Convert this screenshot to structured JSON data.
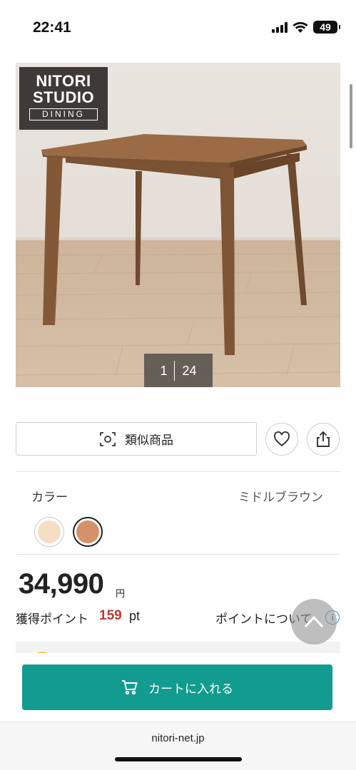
{
  "status_bar": {
    "time": "22:41",
    "battery": "49"
  },
  "product": {
    "brand_logo": {
      "line1": "NITORI",
      "line2": "STUDIO",
      "line3": "DINING"
    },
    "image_counter": {
      "current": "1",
      "total": "24"
    }
  },
  "actions": {
    "similar_label": "類似商品",
    "favorite_icon": "heart-icon",
    "share_icon": "share-icon"
  },
  "color": {
    "label": "カラー",
    "selected_value": "ミドルブラウン",
    "swatches": [
      {
        "color": "#f5dec4",
        "selected": false
      },
      {
        "color": "#d6906a",
        "selected": true
      }
    ]
  },
  "price": {
    "amount": "34,990",
    "unit": "円"
  },
  "points": {
    "label": "獲得ポイント",
    "value": "159",
    "unit": "pt",
    "info_label": "ポイントについて"
  },
  "cart": {
    "button_label": "カートに入れる"
  },
  "browser": {
    "url": "nitori-net.jp"
  },
  "colors": {
    "accent": "#129c8f",
    "points": "#c0392b",
    "info": "#3a8ed6"
  }
}
